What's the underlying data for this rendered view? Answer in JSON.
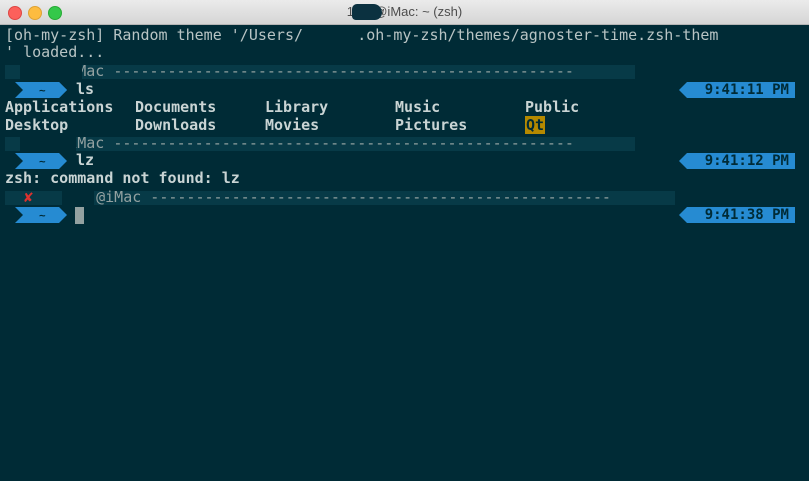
{
  "window": {
    "title": "1. …@iMac: ~ (zsh)"
  },
  "terminal": {
    "banner_line1": "[oh-my-zsh] Random theme '/Users/      .oh-my-zsh/themes/agnoster-time.zsh-them",
    "banner_line2": "' loaded...",
    "prompts": [
      {
        "host": "@iMac",
        "dir": "~",
        "command": "ls",
        "time": "9:41:11 PM"
      },
      {
        "host": "@iMac",
        "dir": "~",
        "command": "lz",
        "time": "9:41:12 PM"
      },
      {
        "host": "@iMac",
        "dir": "~",
        "command": "",
        "time": "9:41:38 PM",
        "error_icon": "✘"
      }
    ],
    "ls_output": {
      "row1": [
        "Applications",
        "Documents",
        "Library",
        "Music",
        "Public"
      ],
      "row2": [
        "Desktop",
        "Downloads",
        "Movies",
        "Pictures",
        "Qt"
      ]
    },
    "error_message": "zsh: command not found: lz"
  },
  "colors": {
    "background": "#002b36",
    "prompt_blue": "#268bd2",
    "error_red": "#dc322f",
    "highlight_yellow": "#b58900"
  }
}
